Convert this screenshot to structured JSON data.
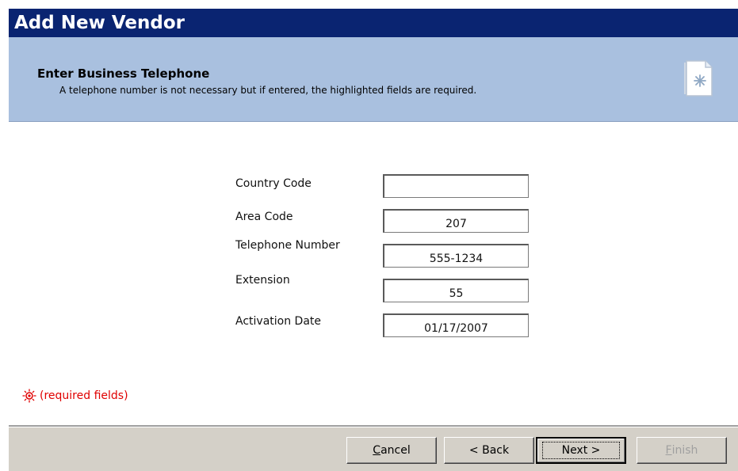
{
  "window": {
    "title": "Add New Vendor"
  },
  "header": {
    "title": "Enter Business Telephone",
    "subtitle": "A telephone number is not necessary but if entered, the highlighted fields are required.",
    "icon": "wizard-page-icon"
  },
  "form": {
    "fields": [
      {
        "label": "Country Code",
        "value": ""
      },
      {
        "label": "Area Code",
        "value": "207"
      },
      {
        "label": "Telephone Number",
        "value": "555-1234"
      },
      {
        "label": "Extension",
        "value": "55"
      },
      {
        "label": "Activation Date",
        "value": "01/17/2007"
      }
    ]
  },
  "required_note": {
    "icon": "required-field-icon",
    "text": "(required fields)",
    "color": "#e00000"
  },
  "buttons": {
    "cancel": {
      "accel": "C",
      "rest": "ancel"
    },
    "back": "< Back",
    "next": "Next >",
    "finish": {
      "accel": "F",
      "rest": "inish"
    }
  },
  "colors": {
    "titlebar": "#0a2471",
    "header": "#a9c0df",
    "footer": "#d4d0c8"
  }
}
